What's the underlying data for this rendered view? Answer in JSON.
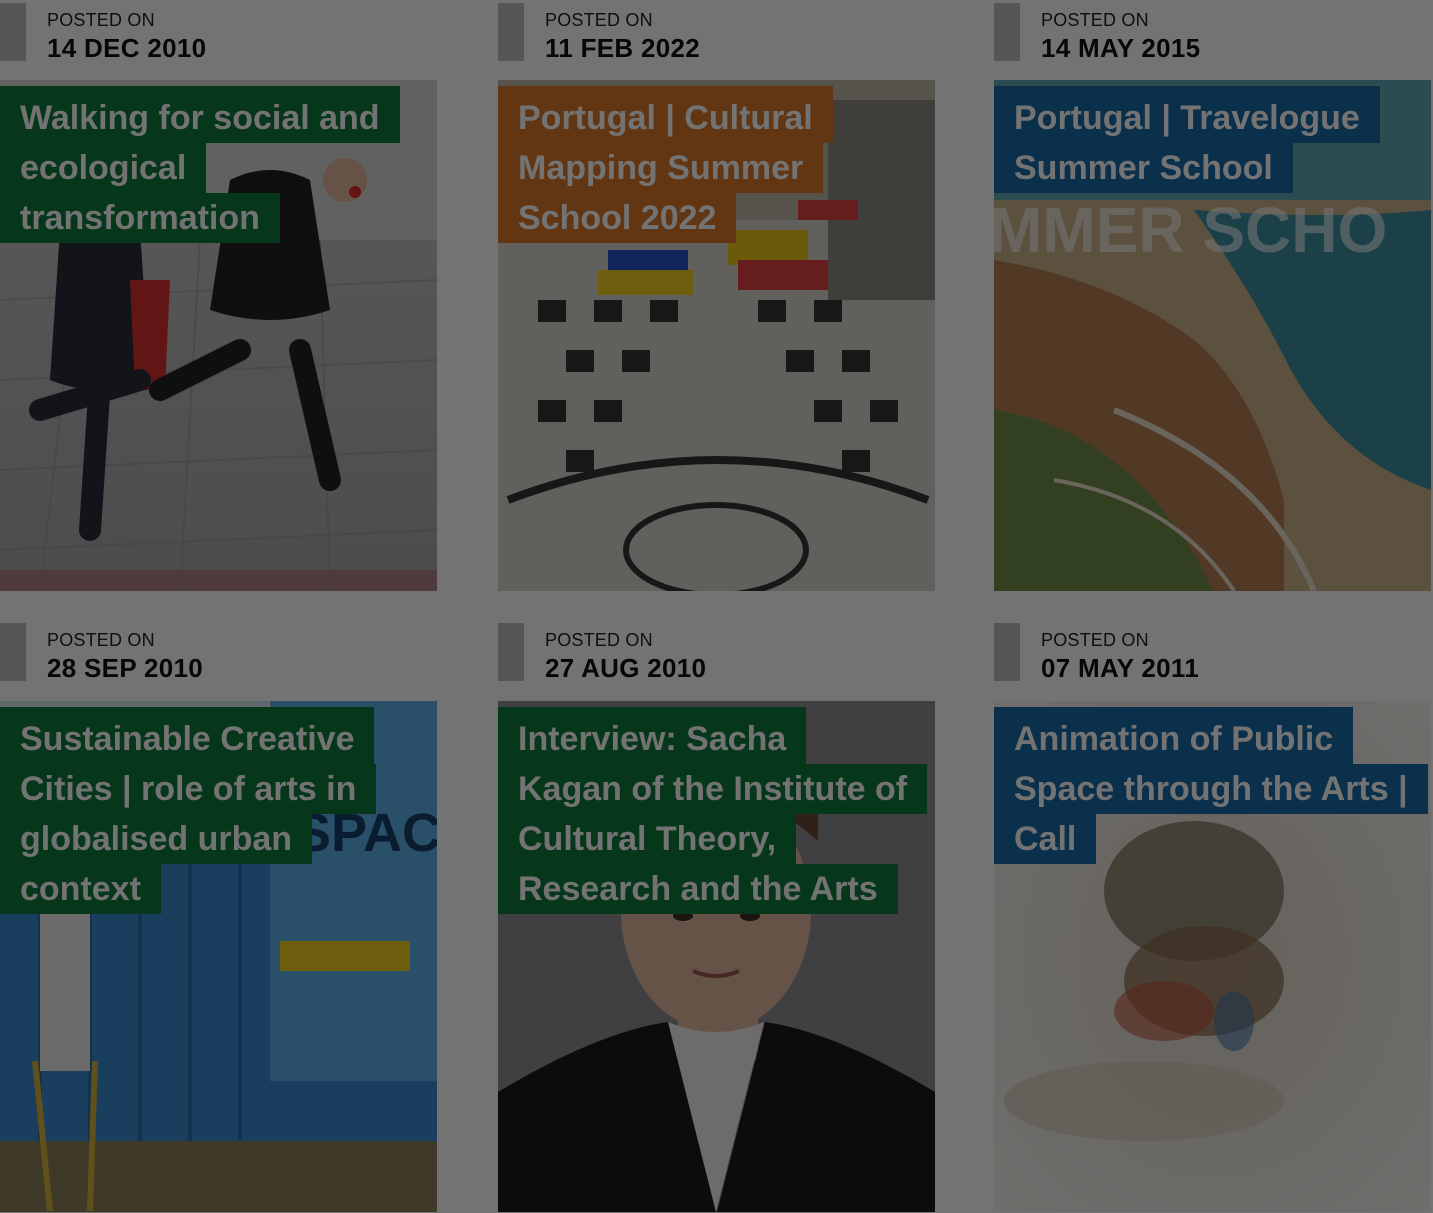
{
  "posts": [
    {
      "posted_label": "POSTED ON",
      "date": "14 DEC 2010",
      "title_lines": [
        "Walking for social and",
        "ecological",
        "transformation"
      ],
      "title_color": "#0f7a3a",
      "image_icon": "street-performers-photo"
    },
    {
      "posted_label": "POSTED ON",
      "date": "11 FEB 2022",
      "title_lines": [
        "Portugal | Cultural",
        "Mapping Summer",
        "School 2022"
      ],
      "title_color": "#d9782a",
      "image_icon": "town-square-market-photo"
    },
    {
      "posted_label": "POSTED ON",
      "date": "14 MAY 2015",
      "title_lines": [
        "Portugal | Travelogue",
        "Summer School"
      ],
      "title_color": "#1a6aa8",
      "image_icon": "aerial-coast-photo",
      "image_text": "MMER SCHO"
    },
    {
      "posted_label": "POSTED ON",
      "date": "28 SEP 2010",
      "title_lines": [
        "Sustainable Creative",
        "Cities | role of arts in",
        "globalised urban",
        "context"
      ],
      "title_color": "#0f7a3a",
      "image_icon": "public-space-container-photo",
      "image_text": "SPACE"
    },
    {
      "posted_label": "POSTED ON",
      "date": "27 AUG 2010",
      "title_lines": [
        "Interview: Sacha",
        "Kagan of the Institute of",
        "Cultural Theory,",
        "Research and the Arts"
      ],
      "title_color": "#0f7a3a",
      "image_icon": "portrait-photo"
    },
    {
      "posted_label": "POSTED ON",
      "date": "07 MAY 2011",
      "title_lines": [
        "Animation of Public",
        "Space through the Arts |",
        "Call"
      ],
      "title_color": "#1a6aa8",
      "image_icon": "blurred-street-art-photo"
    }
  ]
}
